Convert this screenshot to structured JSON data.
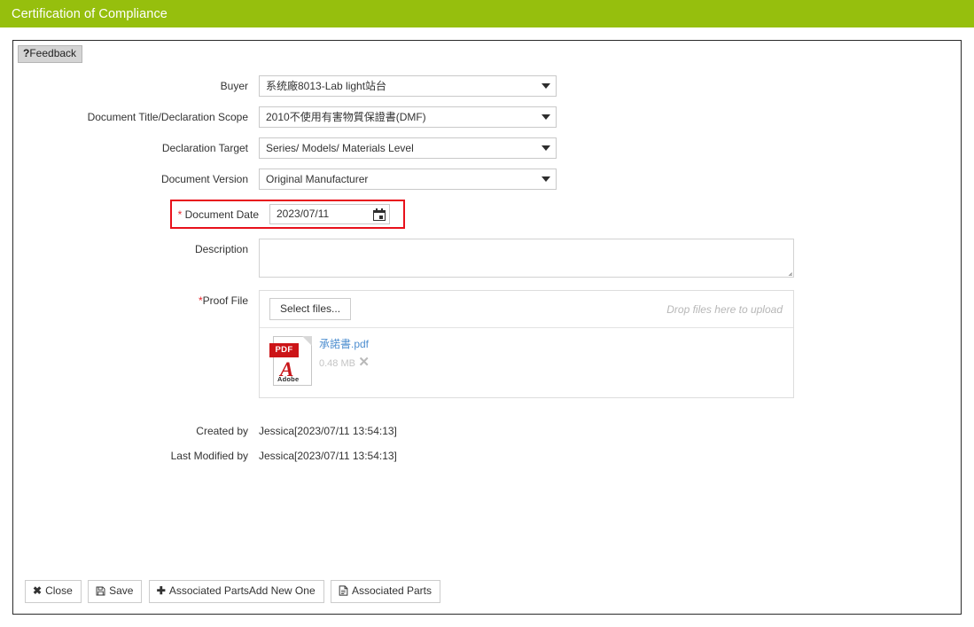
{
  "window": {
    "title": "Certification of Compliance",
    "header_color": "#96bf0d"
  },
  "tabs": {
    "feedback": {
      "qmark": "?",
      "label": "Feedback"
    }
  },
  "form": {
    "buyer": {
      "label": "Buyer",
      "value": "系统廠8013-Lab light站台"
    },
    "document_title": {
      "label": "Document Title/Declaration Scope",
      "value": "2010不使用有害物質保證書(DMF)"
    },
    "declaration_target": {
      "label": "Declaration Target",
      "value": "Series/ Models/ Materials Level"
    },
    "document_version": {
      "label": "Document Version",
      "value": "Original Manufacturer"
    },
    "document_date": {
      "asterisk": "*",
      "label": " Document Date",
      "value": "2023/07/11",
      "highlight_color": "#e8111b",
      "icon": "calendar-icon"
    },
    "description": {
      "label": "Description",
      "value": "",
      "placeholder": ""
    },
    "proof_file": {
      "asterisk": "*",
      "label": "Proof File",
      "select_button": "Select files...",
      "drop_hint": "Drop files here to upload",
      "files": [
        {
          "name": "承諾書.pdf",
          "size": "0.48 MB",
          "type": "PDF",
          "badge": "PDF",
          "brand": "Adobe",
          "remove": "✕"
        }
      ]
    },
    "created_by": {
      "label": "Created by",
      "value": "Jessica[2023/07/11 13:54:13]"
    },
    "last_modified_by": {
      "label": "Last Modified by",
      "value": "Jessica[2023/07/11 13:54:13]"
    }
  },
  "footer": {
    "buttons": [
      {
        "icon": "close-icon",
        "glyph": "✖",
        "label": "Close"
      },
      {
        "icon": "save-icon",
        "glyph": "",
        "label": "Save"
      },
      {
        "icon": "plus-icon",
        "glyph": "✚",
        "label": "Add New One"
      },
      {
        "icon": "document-icon",
        "glyph": "",
        "label": "Associated Parts"
      }
    ]
  }
}
